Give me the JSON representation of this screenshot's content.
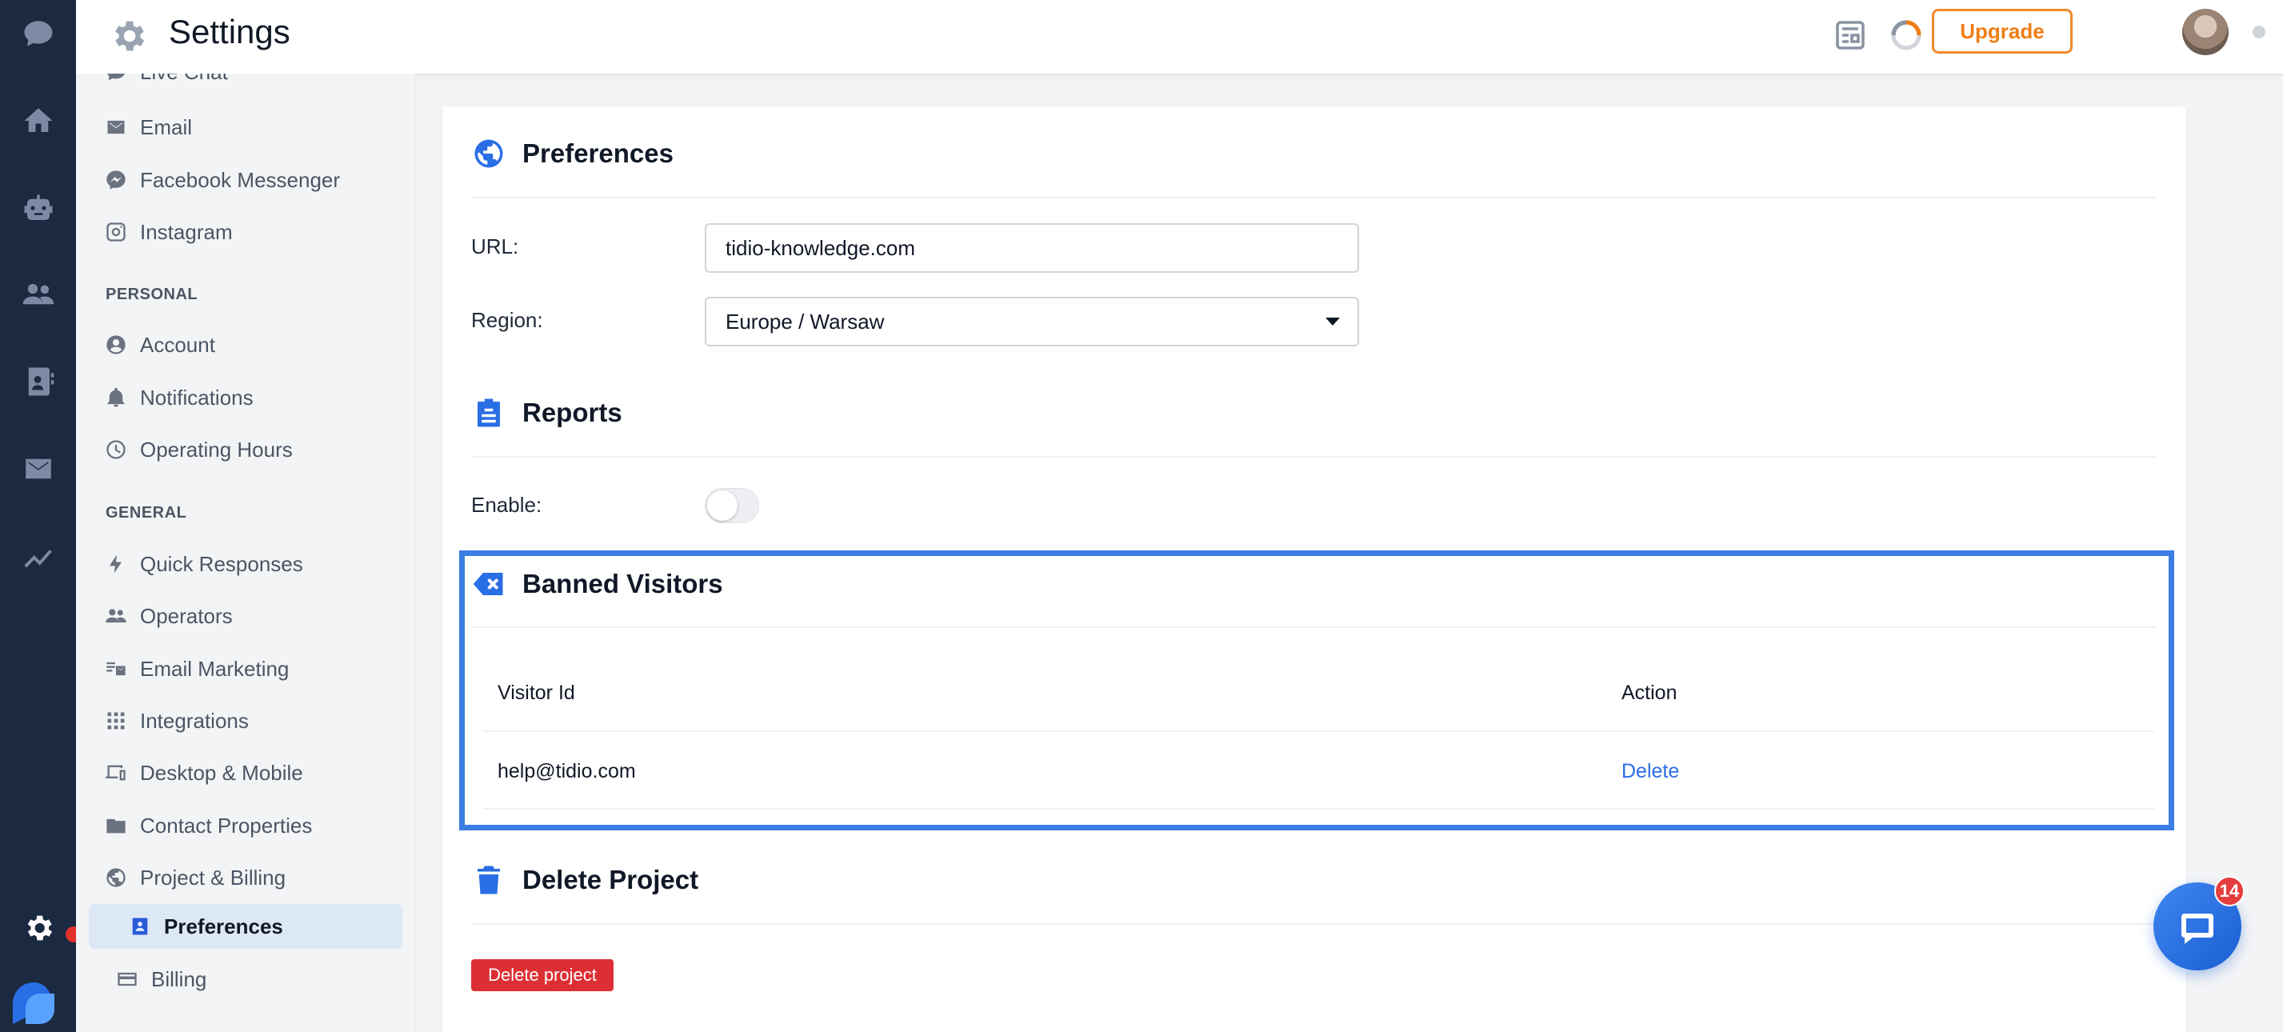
{
  "topbar": {
    "title": "Settings",
    "upgrade_label": "Upgrade"
  },
  "sidebar": {
    "items_top": [
      {
        "label": "Live Chat",
        "icon": "chat-bubble-icon"
      },
      {
        "label": "Email",
        "icon": "envelope-icon"
      },
      {
        "label": "Facebook Messenger",
        "icon": "messenger-icon"
      },
      {
        "label": "Instagram",
        "icon": "instagram-icon"
      }
    ],
    "personal_header": "PERSONAL",
    "personal": [
      {
        "label": "Account",
        "icon": "user-circle-icon"
      },
      {
        "label": "Notifications",
        "icon": "bell-icon"
      },
      {
        "label": "Operating Hours",
        "icon": "clock-icon"
      }
    ],
    "general_header": "GENERAL",
    "general": [
      {
        "label": "Quick Responses",
        "icon": "bolt-icon"
      },
      {
        "label": "Operators",
        "icon": "people-icon"
      },
      {
        "label": "Email Marketing",
        "icon": "email-marketing-icon"
      },
      {
        "label": "Integrations",
        "icon": "grid-icon"
      },
      {
        "label": "Desktop & Mobile",
        "icon": "devices-icon"
      },
      {
        "label": "Contact Properties",
        "icon": "folder-icon"
      },
      {
        "label": "Project & Billing",
        "icon": "globe-icon"
      },
      {
        "label": "Preferences",
        "icon": "badge-icon"
      },
      {
        "label": "Billing",
        "icon": "credit-card-icon"
      }
    ]
  },
  "preferences": {
    "title": "Preferences",
    "url_label": "URL:",
    "url_value": "tidio-knowledge.com",
    "region_label": "Region:",
    "region_value": "Europe / Warsaw"
  },
  "reports": {
    "title": "Reports",
    "enable_label": "Enable:",
    "enabled": false
  },
  "banned": {
    "title": "Banned Visitors",
    "col_visitor": "Visitor Id",
    "col_action": "Action",
    "rows": [
      {
        "visitor": "help@tidio.com",
        "action": "Delete"
      }
    ]
  },
  "delete_project": {
    "title": "Delete Project",
    "button_label": "Delete project"
  },
  "chat_widget": {
    "badge_count": "14"
  },
  "colors": {
    "accent": "#2a6ee6",
    "upgrade": "#f07d15",
    "danger": "#dc2f34",
    "highlight": "#3b7de3",
    "rail": "#1b2a40"
  }
}
